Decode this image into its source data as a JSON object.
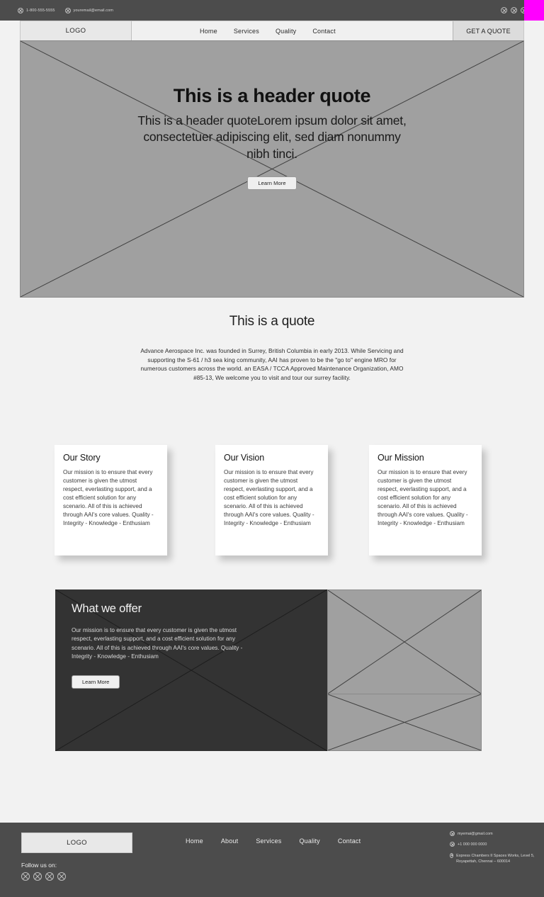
{
  "topbar": {
    "phone": "1-800-555-5555",
    "email": "youremail@email.com",
    "social_icons": [
      "social-icon-1",
      "social-icon-2",
      "social-icon-3",
      "social-icon-4"
    ],
    "accent_color": "#ff00ff",
    "background_color": "#4c4c4c"
  },
  "nav": {
    "logo": "LOGO",
    "links": [
      {
        "label": "Home"
      },
      {
        "label": "Services"
      },
      {
        "label": "Quality"
      },
      {
        "label": "Contact"
      }
    ],
    "cta_label": "GET A QUOTE"
  },
  "hero": {
    "title": "This is a header quote",
    "subtitle": "This is a header quoteLorem ipsum dolor sit amet, consectetuer adipiscing elit, sed diam nonummy nibh tinci.",
    "button_label": "Learn More",
    "placeholder_color": "#a0a0a0"
  },
  "quote": {
    "title": "This is a quote",
    "body": "Advance Aerospace Inc. was founded in Surrey, British Columbia in early 2013. While Servicing and supporting the S-61 / h3 sea king community, AAI has proven to be the \"go to\" engine MRO for numerous customers across the world. an EASA / TCCA Approved Maintenance Organization, AMO #85-13, We welcome you to visit and tour our surrey facility."
  },
  "cards": [
    {
      "title": "Our Story",
      "body": "Our mission is to ensure that every customer is given the utmost respect, everlasting support, and a cost efficient solution for any scenario. All of this is achieved through AAI's core values. Quality - Integrity - Knowledge - Enthusiam"
    },
    {
      "title": "Our Vision",
      "body": "Our mission is to ensure that every customer is given the utmost respect, everlasting support, and a cost efficient solution for any scenario. All of this is achieved through AAI's core values. Quality - Integrity - Knowledge - Enthusiam"
    },
    {
      "title": "Our Mission",
      "body": "Our mission is to ensure that every customer is given the utmost respect, everlasting support, and a cost efficient solution for any scenario. All of this is achieved through AAI's core values. Quality - Integrity - Knowledge - Enthusiam"
    }
  ],
  "offer": {
    "title": "What we offer",
    "body": "Our mission is to ensure that every customer is given the utmost respect, everlasting support, and a cost efficient solution for any scenario. All of this is achieved through AAI's core values. Quality - Integrity - Knowledge - Enthusiam",
    "button_label": "Learn More",
    "background_color": "#333333"
  },
  "footer": {
    "logo": "LOGO",
    "follow_label": "Follow us on:",
    "social_icons": [
      "social-icon-1",
      "social-icon-2",
      "social-icon-3",
      "social-icon-4"
    ],
    "links": [
      {
        "label": "Home"
      },
      {
        "label": "About"
      },
      {
        "label": "Services"
      },
      {
        "label": "Quality"
      },
      {
        "label": "Contact"
      }
    ],
    "contact": {
      "email": "myemai@gmail.com",
      "phone": "+1 000 000 0000",
      "address": "Express Chambers II Spaces Works, Level 5, Royapettah, Chennai – 600014"
    },
    "background_color": "#4c4c4c"
  }
}
